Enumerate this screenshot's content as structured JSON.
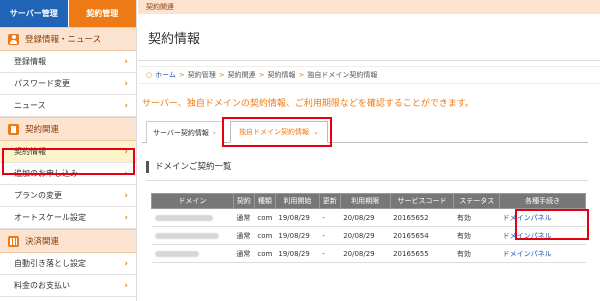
{
  "sidebar": {
    "tabs": [
      "サーバー管理",
      "契約管理"
    ],
    "sections": [
      {
        "title": "登録情報・ニュース",
        "icon": "person-icon",
        "items": [
          "登録情報",
          "パスワード変更",
          "ニュース"
        ]
      },
      {
        "title": "契約関連",
        "icon": "document-icon",
        "items": [
          "契約情報",
          "追加のお申し込み",
          "プランの変更",
          "オートスケール設定"
        ]
      },
      {
        "title": "決済関連",
        "icon": "calculator-icon",
        "items": [
          "自動引き落とし設定",
          "料金のお支払い"
        ]
      }
    ],
    "active_item": "契約情報",
    "chevron": "›"
  },
  "header": {
    "topbar": "契約関連",
    "title": "契約情報"
  },
  "breadcrumb": {
    "home": "ホーム",
    "items": [
      "契約管理",
      "契約関連",
      "契約情報",
      "独自ドメイン契約情報"
    ],
    "separator": ">"
  },
  "lead_text": "サーバー、独自ドメインの契約情報、ご利用期限などを確認することができます。",
  "tabs": {
    "server": "サーバー契約情報",
    "domain": "独自ドメイン契約情報",
    "server_chevron": "›",
    "domain_chevron": "⌄"
  },
  "section_title": "ドメインご契約一覧",
  "table": {
    "columns": [
      "ドメイン",
      "契約",
      "種類",
      "利用開始",
      "更新",
      "利用期限",
      "サービスコード",
      "ステータス",
      "各種手続き"
    ],
    "rows": [
      [
        "",
        "通常",
        "com",
        "19/08/29",
        "-",
        "20/08/29",
        "20165652",
        "有効",
        "ドメインパネル"
      ],
      [
        "",
        "通常",
        "com",
        "19/08/29",
        "-",
        "20/08/29",
        "20165654",
        "有効",
        "ドメインパネル"
      ],
      [
        "",
        "通常",
        "com",
        "19/08/29",
        "-",
        "20/08/29",
        "20165655",
        "有効",
        "ドメインパネル"
      ]
    ]
  },
  "colors": {
    "brand_orange": "#ee7a16",
    "brand_blue": "#1f64b6",
    "highlight_red": "#e60012",
    "link_blue": "#1a55b0"
  }
}
